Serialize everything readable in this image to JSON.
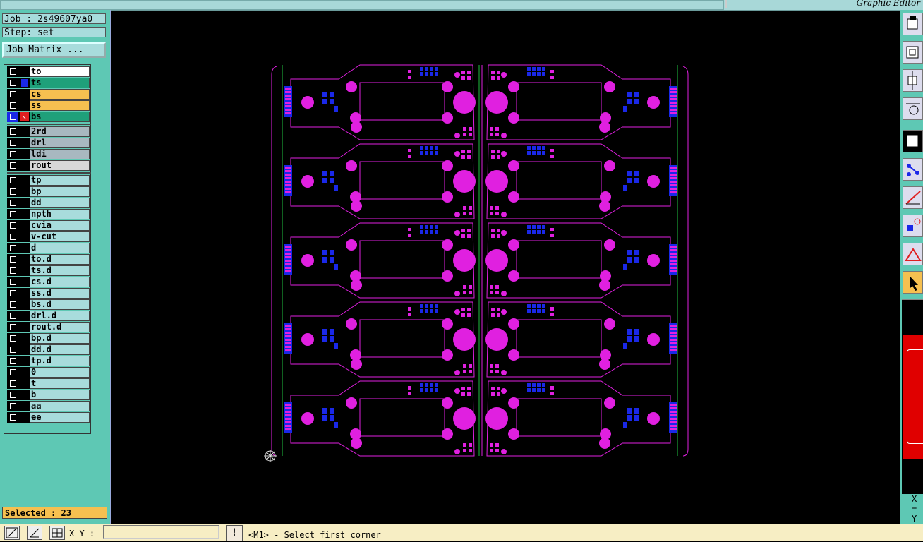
{
  "titlebar": {
    "title": "Graphic Editor"
  },
  "job": {
    "label": "Job : 2s49607ya0",
    "step": "Step: set",
    "matrix_button": "Job Matrix ..."
  },
  "layers_group1": [
    {
      "name": "to",
      "color": "#ffffff"
    },
    {
      "name": "ts",
      "color": "#1fa07a"
    },
    {
      "name": "cs",
      "color": "#f6c050"
    },
    {
      "name": "ss",
      "color": "#f6c050"
    },
    {
      "name": "bs",
      "color": "#1fa07a"
    }
  ],
  "layers_group2": [
    {
      "name": "2rd",
      "color": "#a8b8c0"
    },
    {
      "name": "drl",
      "color": "#a8b8c0"
    },
    {
      "name": "ldi",
      "color": "#a8b8c0"
    },
    {
      "name": "rout",
      "color": "#d8d8d8"
    }
  ],
  "layers_group3": [
    {
      "name": "tp"
    },
    {
      "name": "bp"
    },
    {
      "name": "dd"
    },
    {
      "name": "npth"
    },
    {
      "name": "cvia"
    },
    {
      "name": "v-cut"
    },
    {
      "name": "d"
    },
    {
      "name": "to.d"
    },
    {
      "name": "ts.d"
    },
    {
      "name": "cs.d"
    },
    {
      "name": "ss.d"
    },
    {
      "name": "bs.d"
    },
    {
      "name": "drl.d"
    },
    {
      "name": "rout.d"
    },
    {
      "name": "bp.d"
    },
    {
      "name": "dd.d"
    },
    {
      "name": "tp.d"
    },
    {
      "name": "0"
    },
    {
      "name": "t"
    },
    {
      "name": "b"
    },
    {
      "name": "aa"
    },
    {
      "name": "ee"
    }
  ],
  "selected": "Selected : 23",
  "bottom": {
    "xy_label": "X Y :",
    "xy_value": "",
    "exclaim": "!",
    "status": "<M1> - Select first corner"
  },
  "coords": {
    "x": "X =",
    "y": "Y ="
  },
  "colors": {
    "board": "#e020e0",
    "pads_blue": "#1a28e8",
    "outline_green": "#20c040",
    "panel_bg": "#5ec8b4"
  },
  "icons": [
    "layers-icon",
    "zoom-fit-icon",
    "move-icon",
    "scale-icon",
    "select-icon",
    "route-icon",
    "draw-line-icon",
    "pad-icon",
    "triangle-icon",
    "pointer-icon"
  ]
}
